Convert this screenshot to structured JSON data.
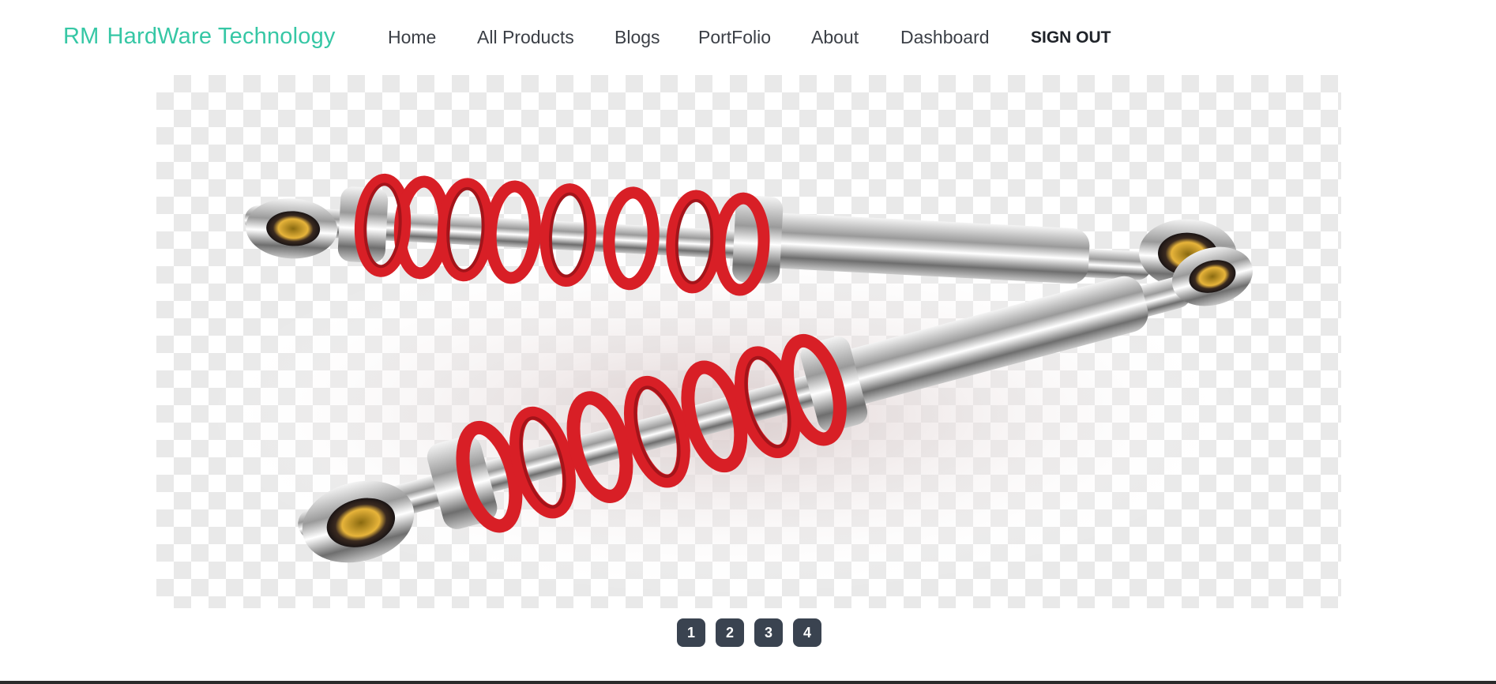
{
  "brand": {
    "name": "RM",
    "subtitle": "HardWare Technology",
    "color": "#36c7a5"
  },
  "nav": {
    "home": "Home",
    "all_products": "All Products",
    "blogs": "Blogs",
    "portfolio": "PortFolio",
    "about": "About",
    "dashboard": "Dashboard",
    "sign_out": "SIGN OUT"
  },
  "hero": {
    "image": "shock-absorber-pair",
    "accent_color": "#d81f26"
  },
  "carousel": {
    "pages": [
      "1",
      "2",
      "3",
      "4"
    ],
    "button_color": "#3a4350"
  }
}
